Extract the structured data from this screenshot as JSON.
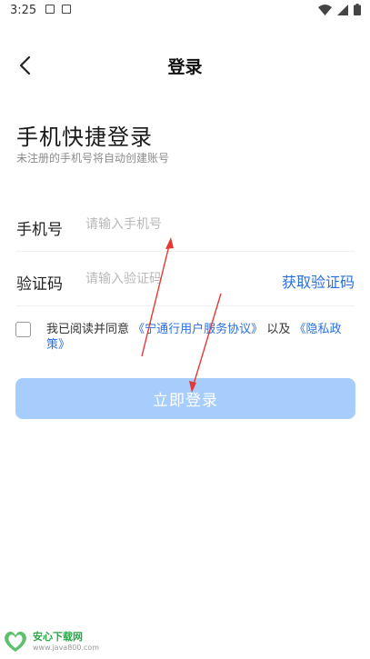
{
  "status_bar": {
    "time": "3:25"
  },
  "nav": {
    "title": "登录"
  },
  "header": {
    "headline": "手机快捷登录",
    "subline": "未注册的手机号将自动创建账号"
  },
  "phone": {
    "label": "手机号",
    "placeholder": "请输入手机号"
  },
  "code": {
    "label": "验证码",
    "placeholder": "请输入验证码",
    "get_code": "获取验证码"
  },
  "agreement": {
    "prefix": "我已阅读并同意",
    "service_link": "《宁通行用户服务协议》",
    "middle": "以及",
    "privacy_link": "《隐私政策》"
  },
  "login_button": {
    "label": "立即登录"
  },
  "watermark": {
    "title": "安心下载网",
    "url": "www.java800.com"
  },
  "colors": {
    "accent": "#2a6fe0",
    "button_disabled": "#a6cdfb",
    "annotation": "#e53935"
  }
}
